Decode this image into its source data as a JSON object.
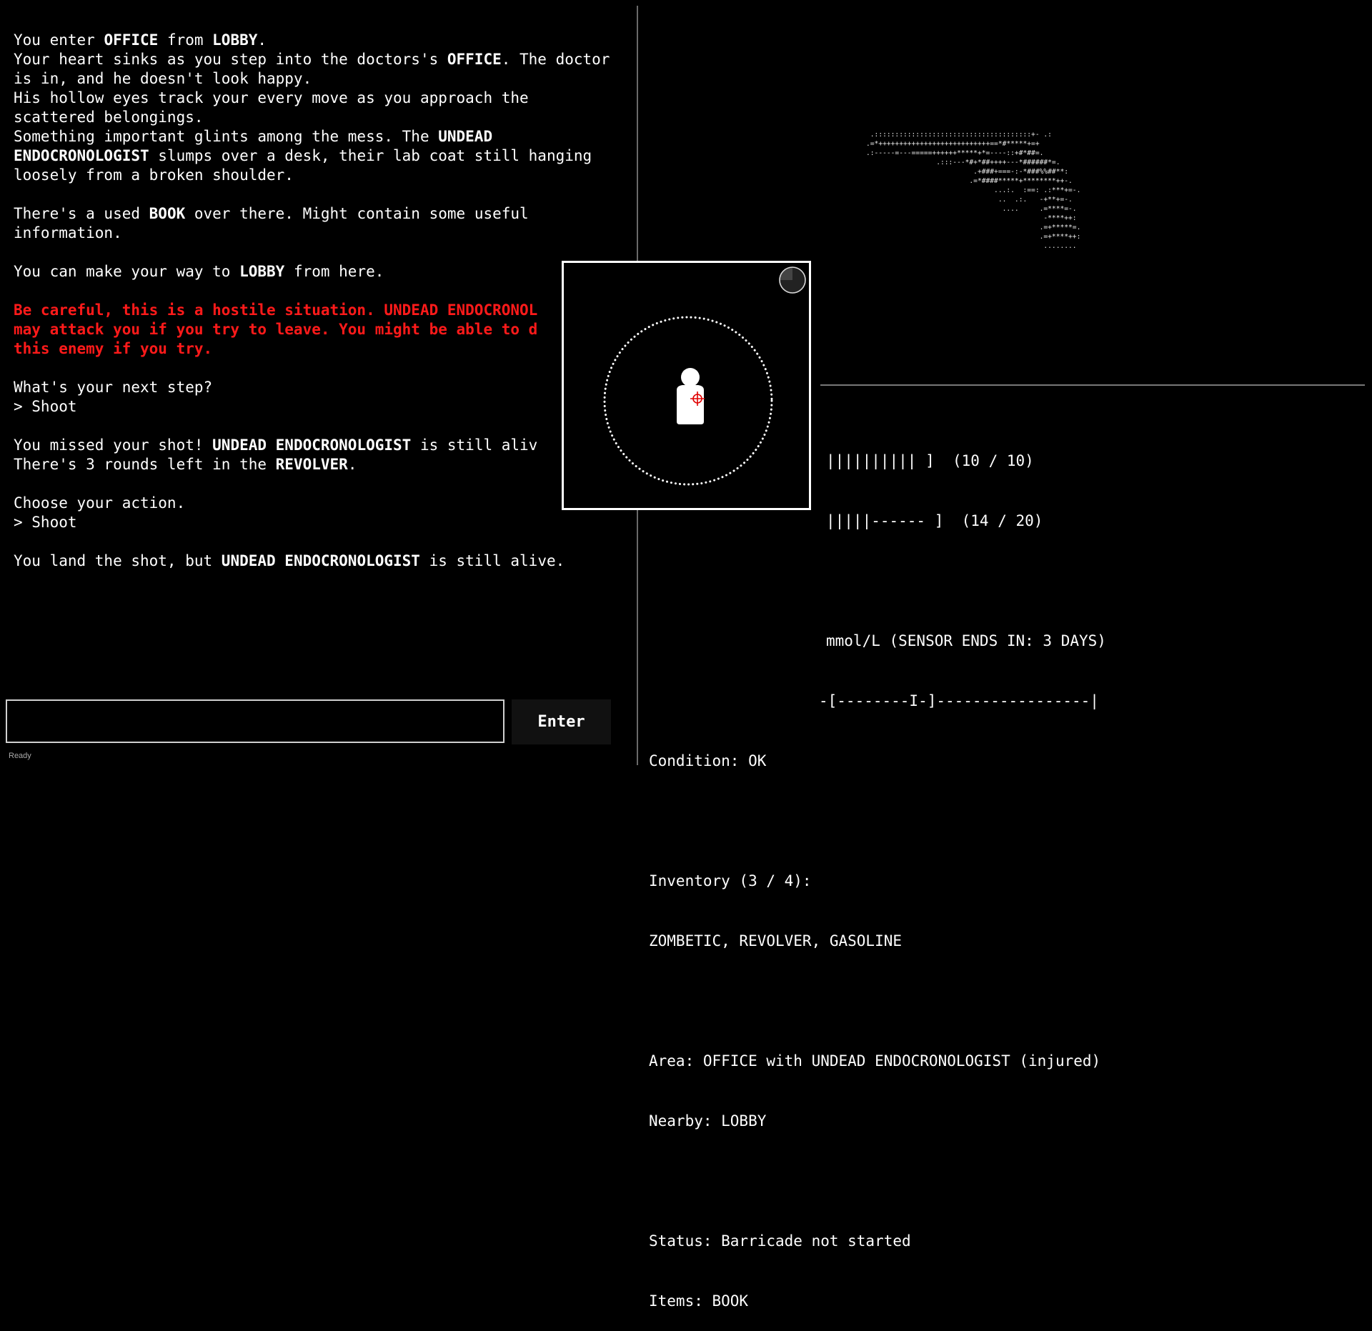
{
  "log": {
    "lines": [
      {
        "segments": [
          {
            "t": "You enter "
          },
          {
            "t": "OFFICE",
            "b": true
          },
          {
            "t": " from "
          },
          {
            "t": "LOBBY",
            "b": true
          },
          {
            "t": "."
          }
        ]
      },
      {
        "segments": [
          {
            "t": "Your heart sinks as you step into the doctors's "
          },
          {
            "t": "OFFICE",
            "b": true
          },
          {
            "t": ". The doctor"
          }
        ]
      },
      {
        "segments": [
          {
            "t": "is in, and he doesn't look happy."
          }
        ]
      },
      {
        "segments": [
          {
            "t": "His hollow eyes track your every move as you approach the"
          }
        ]
      },
      {
        "segments": [
          {
            "t": "scattered belongings."
          }
        ]
      },
      {
        "segments": [
          {
            "t": "Something important glints among the mess. The "
          },
          {
            "t": "UNDEAD",
            "b": true
          }
        ]
      },
      {
        "segments": [
          {
            "t": "ENDOCRONOLOGIST",
            "b": true
          },
          {
            "t": " slumps over a desk, their lab coat still hanging"
          }
        ]
      },
      {
        "segments": [
          {
            "t": "loosely from a broken shoulder."
          }
        ]
      },
      {
        "segments": []
      },
      {
        "segments": [
          {
            "t": "There's a used "
          },
          {
            "t": "BOOK",
            "b": true
          },
          {
            "t": " over there. Might contain some useful"
          }
        ]
      },
      {
        "segments": [
          {
            "t": "information."
          }
        ]
      },
      {
        "segments": []
      },
      {
        "segments": [
          {
            "t": "You can make your way to "
          },
          {
            "t": "LOBBY",
            "b": true
          },
          {
            "t": " from here."
          }
        ]
      },
      {
        "segments": []
      },
      {
        "warn": true,
        "segments": [
          {
            "t": "Be careful, this is a hostile situation. UNDEAD ENDOCRONOL"
          }
        ]
      },
      {
        "warn": true,
        "segments": [
          {
            "t": "may attack you if you try to leave. You might be able to d"
          }
        ]
      },
      {
        "warn": true,
        "segments": [
          {
            "t": "this enemy if you try."
          }
        ]
      },
      {
        "segments": []
      },
      {
        "segments": [
          {
            "t": "What's your next step?"
          }
        ]
      },
      {
        "segments": [
          {
            "t": "> Shoot"
          }
        ]
      },
      {
        "segments": []
      },
      {
        "segments": [
          {
            "t": "You missed your shot! "
          },
          {
            "t": "UNDEAD ENDOCRONOLOGIST",
            "b": true
          },
          {
            "t": " is still aliv"
          }
        ]
      },
      {
        "segments": [
          {
            "t": "There's 3 rounds left in the "
          },
          {
            "t": "REVOLVER",
            "b": true
          },
          {
            "t": "."
          }
        ]
      },
      {
        "segments": []
      },
      {
        "segments": [
          {
            "t": "Choose your action."
          }
        ]
      },
      {
        "segments": [
          {
            "t": "> Shoot"
          }
        ]
      },
      {
        "segments": []
      },
      {
        "segments": [
          {
            "t": "You land the shot, but "
          },
          {
            "t": "UNDEAD ENDOCRONOLOGIST",
            "b": true
          },
          {
            "t": " is still alive."
          }
        ]
      }
    ]
  },
  "input": {
    "value": "",
    "button_label": "Enter",
    "status": "Ready"
  },
  "ascii_art": " .::::::::::::::::::::::::::::::::::::::+- .:\n.=*+++++++++++++++++++++++++++==*#*****+=+\n.:-----=---=====++++++*****+*=----::+#*##=.\n                 .:::---*#+*##++++---*######*=.\n                          .+###+===-:-*###%%##**:\n                         .=*####*****+********++-.\n                               ...:.  :==: .:***+=-.\n                                ..  .:.   -+**+=-.\n                                 ....     .=****=-.\n                                           -****++:\n                                          .=+*****=.\n                                          .=+****++:\n                                           ........",
  "stats": {
    "health_bar": "|||||||||| ]  (10 / 10)",
    "stamina_bar": "|||||------ ]  (14 / 20)",
    "glucose_line": "mmol/L (SENSOR ENDS IN: 3 DAYS)",
    "glucose_scale": "-[--------I-]-----------------|",
    "condition": "Condition: OK",
    "inventory_label": "Inventory (3 / 4):",
    "inventory_items": "ZOMBETIC, REVOLVER, GASOLINE",
    "area": "Area: OFFICE with UNDEAD ENDOCRONOLOGIST (injured)",
    "nearby": "Nearby: LOBBY",
    "status": "Status: Barricade not started",
    "items": "Items: BOOK"
  },
  "popup": {
    "timer_remaining_fraction": 0.25,
    "crosshair_color": "#e00000",
    "icons": [
      "timer-icon",
      "target-silhouette-icon",
      "crosshair-icon"
    ]
  }
}
